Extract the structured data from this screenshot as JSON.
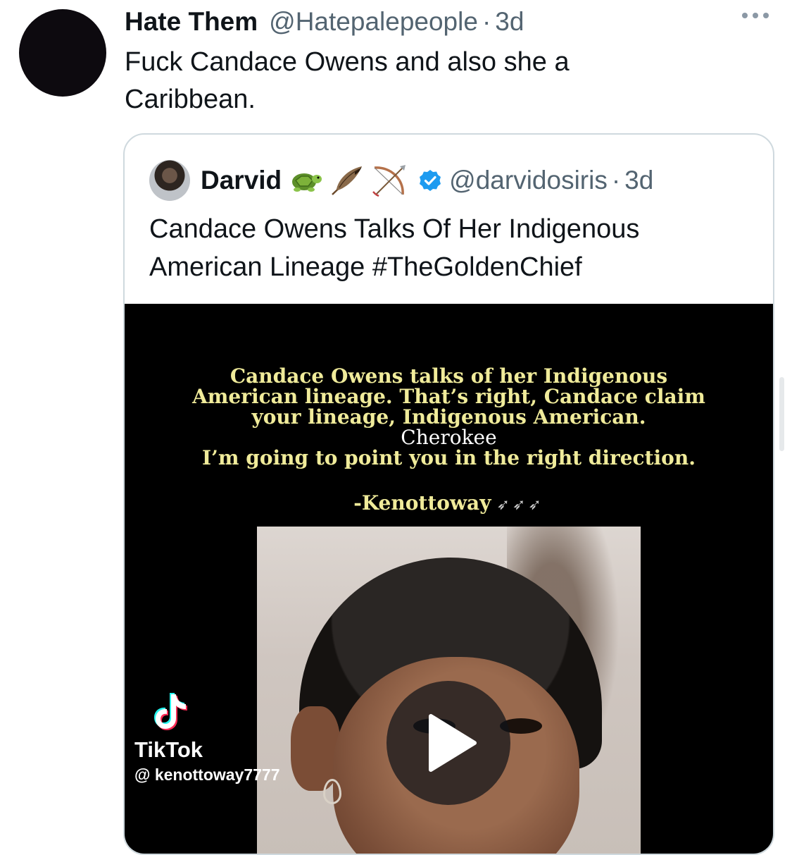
{
  "tweet": {
    "display_name": "Hate Them",
    "handle": "@Hatepalepeople",
    "separator": "·",
    "time": "3d",
    "text_line1": "Fuck Candace Owens and also she a",
    "text_line2": "Caribbean.",
    "more_icon": "more-horizontal-icon"
  },
  "quote": {
    "display_name": "Darvid",
    "name_emojis": [
      "turtle-emoji",
      "feather-emoji",
      "bow-and-arrow-emoji"
    ],
    "verified_icon": "verified-badge-icon",
    "handle": "@darvidosiris",
    "separator": "·",
    "time": "3d",
    "text_line1": "Candace Owens Talks Of Her Indigenous",
    "text_line2": "American Lineage #TheGoldenChief"
  },
  "media": {
    "caption_line1": "Candace Owens talks of her Indigenous",
    "caption_line2": "American lineage. That’s right, Candace claim",
    "caption_line3": "your lineage, Indigenous American.",
    "caption_line4": "Cherokee",
    "caption_line5": "I’m going to point you in the right direction.",
    "signature": "-Kenottoway",
    "watermark_brand": "TikTok",
    "watermark_user": "@ kenottoway7777",
    "play_icon": "play-icon"
  },
  "colors": {
    "text": "#0f1419",
    "secondary": "#536471",
    "border": "#cfd9de",
    "verified": "#1d9bf0",
    "caption_yellow": "#f0eb9a"
  }
}
